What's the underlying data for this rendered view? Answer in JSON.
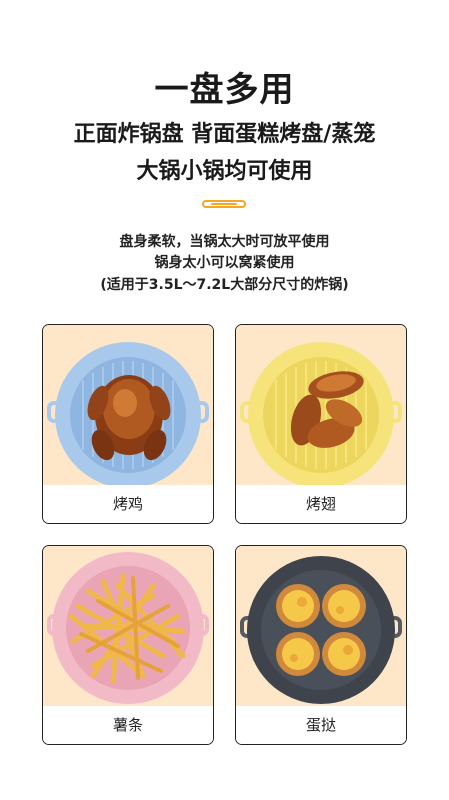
{
  "header": {
    "title": "一盘多用",
    "subtitle_line1": "正面炸锅盘 背面蛋糕烤盘/蒸笼",
    "subtitle_line2": "大锅小锅均可使用"
  },
  "description": {
    "line1": "盘身柔软，当锅太大时可放平使用",
    "line2": "锅身太小可以窝紧使用",
    "line3": "(适用于3.5L～7.2L大部分尺寸的炸锅)"
  },
  "accent_color": "#f5a623",
  "cards": [
    {
      "label": "烤鸡",
      "liner_color": "#a9c9ec",
      "food": "roast-chicken"
    },
    {
      "label": "烤翅",
      "liner_color": "#f6e47a",
      "food": "chicken-wings"
    },
    {
      "label": "薯条",
      "liner_color": "#f2b9c6",
      "food": "french-fries"
    },
    {
      "label": "蛋挞",
      "liner_color": "#3e434c",
      "food": "egg-tarts"
    }
  ]
}
